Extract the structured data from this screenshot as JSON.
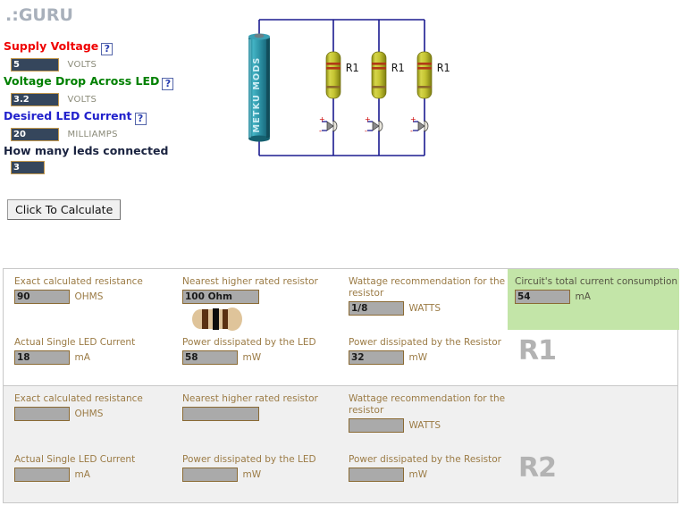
{
  "title": ".:GURU",
  "colors": {
    "supply_label": "#ef0000",
    "drop_label": "#008000",
    "current_label": "#2222cc",
    "leds_label": "#1a2340",
    "input_bg": "#35465c",
    "input_border": "#c59a4e",
    "result_bg": "#aaaaaa",
    "result_border": "#8a6a34",
    "result_label": "#9b7b45",
    "highlight_bg": "#c3e5a8",
    "wire": "#1b1b8f",
    "battery": "#2e95a8",
    "resistor_body": "#c8c832",
    "title_gray": "#a8b0bb"
  },
  "form": {
    "help_icon": "?",
    "fields": [
      {
        "label": "Supply Voltage",
        "value": "5",
        "unit": "VOLTS",
        "has_help": true
      },
      {
        "label": "Voltage Drop Across LED",
        "value": "3.2",
        "unit": "VOLTS",
        "has_help": true
      },
      {
        "label": "Desired LED Current",
        "value": "20",
        "unit": "MILLIAMPS",
        "has_help": true
      },
      {
        "label": "How many leds connected",
        "value": "3",
        "unit": "",
        "has_help": false
      }
    ],
    "calculate_button": "Click To Calculate"
  },
  "circuit": {
    "battery_label": "METKU MODS",
    "resistor_labels": [
      "R1",
      "R1",
      "R1"
    ],
    "branch_count": 3
  },
  "results": {
    "blocks": [
      {
        "tag": "R1",
        "row1": [
          {
            "label": "Exact calculated resistance",
            "value": "90",
            "unit": "OHMS"
          },
          {
            "label": "Nearest higher rated resistor",
            "value": "100 Ohm",
            "unit": "",
            "show_resistor_image": true
          },
          {
            "label": "Wattage recommendation for the resistor",
            "value": "1/8",
            "unit": "WATTS"
          },
          {
            "label": "Circuit's total current consumption",
            "value": "54",
            "unit": "mA",
            "highlight": true
          }
        ],
        "row2": [
          {
            "label": "Actual Single LED Current",
            "value": "18",
            "unit": "mA"
          },
          {
            "label": "Power dissipated by the LED",
            "value": "58",
            "unit": "mW"
          },
          {
            "label": "Power dissipated by the Resistor",
            "value": "32",
            "unit": "mW"
          }
        ]
      },
      {
        "tag": "R2",
        "row1": [
          {
            "label": "Exact calculated resistance",
            "value": "",
            "unit": "OHMS"
          },
          {
            "label": "Nearest higher rated resistor",
            "value": "",
            "unit": "",
            "show_resistor_image": false
          },
          {
            "label": "Wattage recommendation for the resistor",
            "value": "",
            "unit": "WATTS"
          },
          {
            "label": "",
            "value": "",
            "unit": "",
            "empty": true
          }
        ],
        "row2": [
          {
            "label": "Actual Single LED Current",
            "value": "",
            "unit": "mA"
          },
          {
            "label": "Power dissipated by the LED",
            "value": "",
            "unit": "mW"
          },
          {
            "label": "Power dissipated by the Resistor",
            "value": "",
            "unit": "mW"
          }
        ]
      }
    ]
  }
}
